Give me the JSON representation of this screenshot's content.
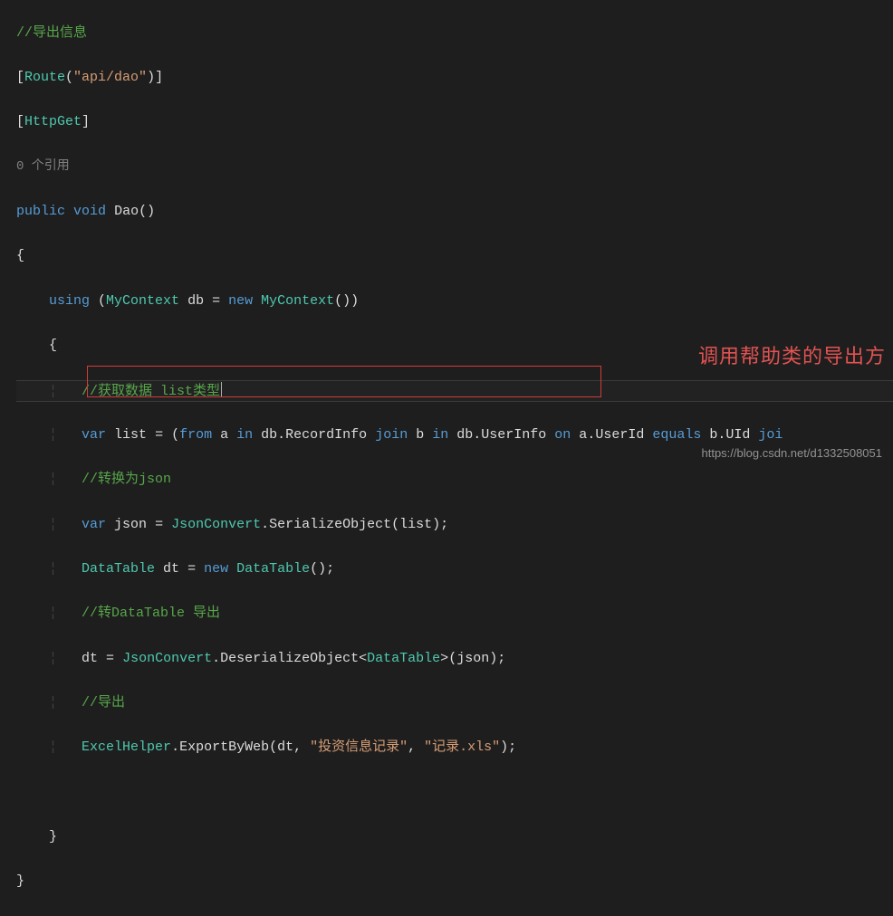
{
  "code": {
    "l1_comment": "//导出信息",
    "l2_route_attr_open": "[",
    "l2_route_type": "Route",
    "l2_route_paren_open": "(",
    "l2_route_str": "\"api/dao\"",
    "l2_route_paren_close": ")",
    "l2_route_attr_close": "]",
    "l3_httpget_open": "[",
    "l3_httpget_type": "HttpGet",
    "l3_httpget_close": "]",
    "l4_references": "0 个引用",
    "l5_public": "public",
    "l5_void": "void",
    "l5_name": "Dao",
    "l5_parens": "()",
    "l6_brace": "{",
    "l7_using": "using",
    "l7_paren1": " (",
    "l7_type1": "MyContext",
    "l7_var": " db ",
    "l7_eq": "= ",
    "l7_new": "new",
    "l7_type2": " MyContext",
    "l7_paren2": "())",
    "l8_brace": "{",
    "l9_comment_a": "//获取数据 ",
    "l9_comment_b": "list类型",
    "l10_var": "var",
    "l10_name": " list ",
    "l10_eq": "= (",
    "l10_from": "from",
    "l10_a": " a ",
    "l10_in1": "in",
    "l10_db1": " db",
    "l10_dot1": ".",
    "l10_rec": "RecordInfo ",
    "l10_join": "join",
    "l10_b": " b ",
    "l10_in2": "in",
    "l10_db2": " db",
    "l10_dot2": ".",
    "l10_user": "UserInfo ",
    "l10_on": "on",
    "l10_a2": " a",
    "l10_dot3": ".",
    "l10_uid1": "UserId ",
    "l10_equals": "equals",
    "l10_b2": " b",
    "l10_dot4": ".",
    "l10_uid2": "UId ",
    "l10_joi": "joi",
    "l11_comment": "//转换为json",
    "l12_var": "var",
    "l12_name": " json ",
    "l12_eq": "= ",
    "l12_class": "JsonConvert",
    "l12_dot": ".",
    "l12_method": "SerializeObject",
    "l12_args": "(list);",
    "l13_type": "DataTable",
    "l13_name": " dt ",
    "l13_eq": "= ",
    "l13_new": "new",
    "l13_type2": " DataTable",
    "l13_paren": "();",
    "l14_comment": "//转DataTable 导出",
    "l15_name": "dt ",
    "l15_eq": "= ",
    "l15_class": "JsonConvert",
    "l15_dot": ".",
    "l15_method": "DeserializeObject",
    "l15_lt": "<",
    "l15_gtype": "DataTable",
    "l15_gt": ">",
    "l15_args": "(json);",
    "l16_comment": "//导出",
    "l17_class": "ExcelHelper",
    "l17_dot": ".",
    "l17_method": "ExportByWeb",
    "l17_p1": "(dt, ",
    "l17_s1": "\"投资信息记录\"",
    "l17_c1": ", ",
    "l17_s2": "\"记录.xls\"",
    "l17_p2": ");",
    "l19_brace": "}",
    "l20_brace": "}"
  },
  "annotation": "调用帮助类的导出方",
  "watermark": "https://blog.csdn.net/d1332508051"
}
